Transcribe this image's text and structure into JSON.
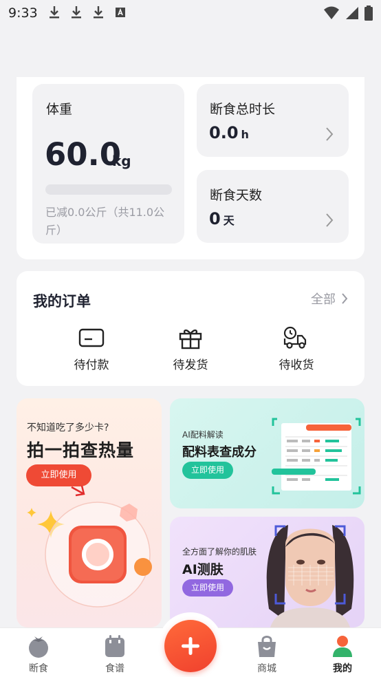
{
  "status_bar": {
    "time": "9:33"
  },
  "stats": {
    "weight": {
      "label": "体重",
      "value": "60.0",
      "unit": "kg",
      "progress": 0,
      "summary": "已减0.0公斤（共11.0公斤）"
    },
    "fasting_total": {
      "label": "断食总时长",
      "value": "0.0",
      "unit": "h"
    },
    "fasting_days": {
      "label": "断食天数",
      "value": "0",
      "unit": "天"
    }
  },
  "orders": {
    "title": "我的订单",
    "all_label": "全部",
    "items": [
      {
        "label": "待付款",
        "icon": "card-icon"
      },
      {
        "label": "待发货",
        "icon": "gift-icon"
      },
      {
        "label": "待收货",
        "icon": "delivery-truck-icon"
      }
    ]
  },
  "promos": {
    "photo": {
      "question": "不知道吃了多少卡?",
      "title": "拍一拍查热量",
      "button": "立即使用"
    },
    "ingredients": {
      "subtitle": "AI配料解读",
      "title": "配料表查成分",
      "button": "立即使用"
    },
    "skin": {
      "subtitle": "全方面了解你的肌肤",
      "title": "AI测肤",
      "button": "立即使用"
    }
  },
  "bottom_nav": {
    "items": [
      {
        "label": "断食",
        "icon": "tomato-icon"
      },
      {
        "label": "食谱",
        "icon": "recipe-calendar-icon"
      },
      {
        "label": "商城",
        "icon": "shopping-bag-icon"
      },
      {
        "label": "我的",
        "icon": "profile-icon"
      }
    ],
    "active": "我的",
    "fab_icon": "plus-icon"
  },
  "colors": {
    "accent": "#f0412e",
    "teal": "#22c39b",
    "purple": "#9168e0",
    "active_nav": "#33b36b"
  }
}
